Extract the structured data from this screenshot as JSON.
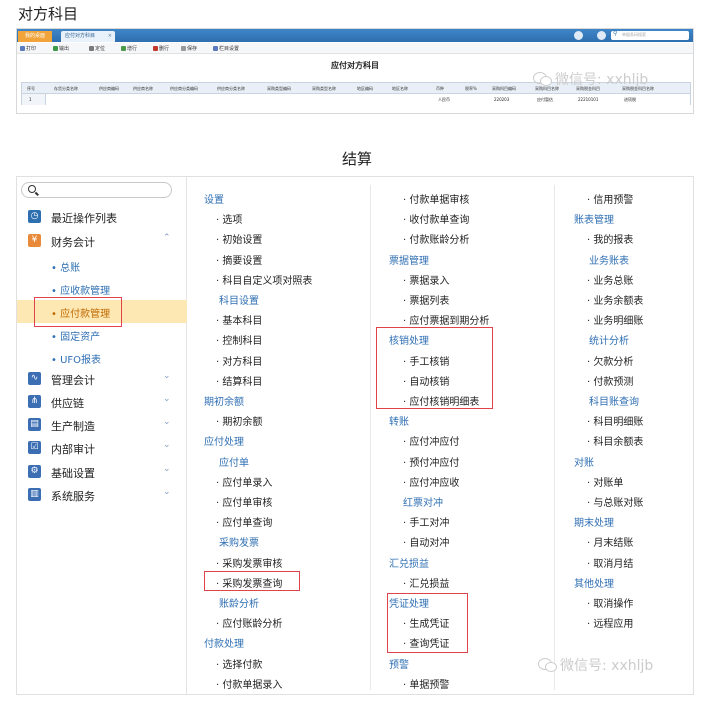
{
  "headings": {
    "top": "对方科目",
    "bottom": "结算"
  },
  "top": {
    "tabs": {
      "home": "我的桌面",
      "active": "应付对方科目",
      "close": "×"
    },
    "search_placeholder": "单据条码搜索",
    "toolbar": [
      "打印",
      "输出",
      "定位",
      "增行",
      "删行",
      "保存",
      "栏目设置"
    ],
    "toolbar_colors": [
      "#5a7cbf",
      "#3a9a4a",
      "#7a7a7a",
      "#4a9a4a",
      "#c0392b",
      "#9a9a9a",
      "#5a7cbf"
    ],
    "form_title": "应付对方科目",
    "columns": [
      "序号",
      "存货分类名称",
      "供应商编码",
      "供应商名称",
      "供应商分类编码",
      "供应商分类名称",
      "采购类型编码",
      "采购类型名称",
      "地区编码",
      "地区名称",
      "币种",
      "税率%",
      "采购科目编码",
      "采购科目名称",
      "采购税金科目",
      "采购税金科目名称"
    ],
    "row": [
      "1",
      "",
      "",
      "",
      "",
      "",
      "",
      "",
      "",
      "",
      "人民币",
      "",
      "220203",
      "应付暂估",
      "22210101",
      "进项税"
    ]
  },
  "watermark": "微信号: xxhljb",
  "sidebar": {
    "items": [
      {
        "label": "最近操作列表",
        "icon": "clock-icon",
        "chev": ""
      },
      {
        "label": "财务会计",
        "icon": "yen-icon",
        "chev": "⌃"
      },
      {
        "label": "管理会计",
        "icon": "chart-icon",
        "chev": "⌄"
      },
      {
        "label": "供应链",
        "icon": "network-icon",
        "chev": "⌄"
      },
      {
        "label": "生产制造",
        "icon": "factory-icon",
        "chev": "⌄"
      },
      {
        "label": "内部审计",
        "icon": "checklist-icon",
        "chev": "⌄"
      },
      {
        "label": "基础设置",
        "icon": "gear-icon",
        "chev": "⌄"
      },
      {
        "label": "系统服务",
        "icon": "server-icon",
        "chev": "⌄"
      }
    ],
    "subitems": [
      "• 总账",
      "• 应收款管理",
      "• 应付款管理",
      "• 固定资产",
      "• UFO报表"
    ]
  },
  "menu": {
    "col1": [
      "设置",
      "· 选项",
      "· 初始设置",
      "· 摘要设置",
      "· 科目自定义项对照表",
      "科目设置",
      "· 基本科目",
      "· 控制科目",
      "· 对方科目",
      "· 结算科目",
      "期初余额",
      "· 期初余额",
      "应付处理",
      "应付单",
      "· 应付单录入",
      "· 应付单审核",
      "· 应付单查询",
      "采购发票",
      "· 采购发票审核",
      "· 采购发票查询",
      "账龄分析",
      "· 应付账龄分析",
      "付款处理",
      "· 选择付款",
      "· 付款单据录入"
    ],
    "col2": [
      "· 付款单据审核",
      "· 收付款单查询",
      "· 付款账龄分析",
      "票据管理",
      "· 票据录入",
      "· 票据列表",
      "· 应付票据到期分析",
      "核销处理",
      "· 手工核销",
      "· 自动核销",
      "· 应付核销明细表",
      "转账",
      "· 应付冲应付",
      "· 预付冲应付",
      "· 应付冲应收",
      "红票对冲",
      "· 手工对冲",
      "· 自动对冲",
      "汇兑损益",
      "· 汇兑损益",
      "凭证处理",
      "· 生成凭证",
      "· 查询凭证",
      "预警",
      "· 单据预警"
    ],
    "col3": [
      "· 信用预警",
      "账表管理",
      "· 我的报表",
      "业务账表",
      "· 业务总账",
      "· 业务余额表",
      "· 业务明细账",
      "统计分析",
      "· 欠款分析",
      "· 付款预测",
      "科目账查询",
      "· 科目明细账",
      "· 科目余额表",
      "对账",
      "· 对账单",
      "· 与总账对账",
      "期末处理",
      "· 月末结账",
      "· 取消月结",
      "其他处理",
      "· 取消操作",
      "· 远程应用"
    ]
  }
}
